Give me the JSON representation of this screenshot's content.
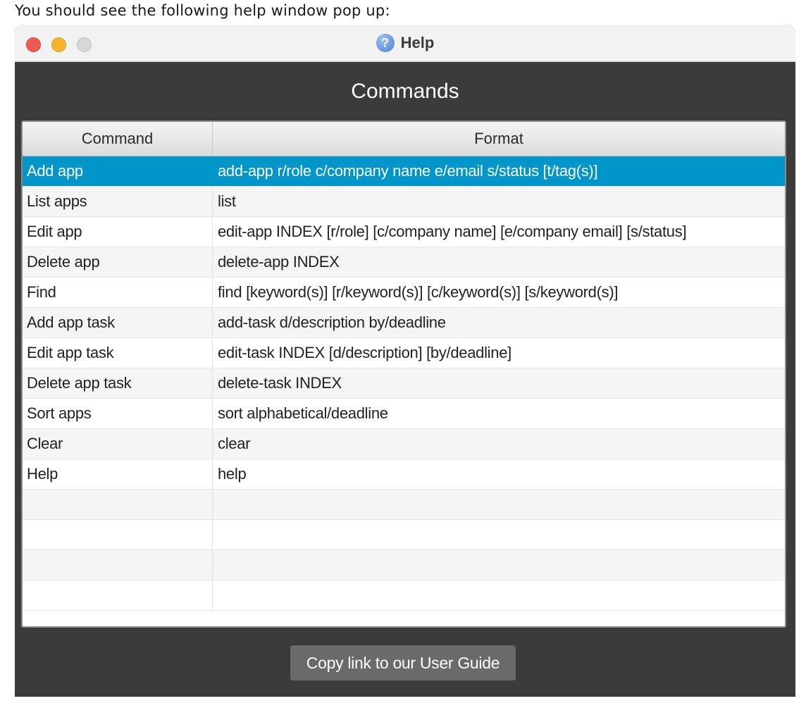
{
  "intro_text": "You should see the following help window pop up:",
  "window": {
    "title": "Help",
    "heading": "Commands"
  },
  "table": {
    "columns": [
      "Command",
      "Format"
    ],
    "selected_row": 0,
    "rows": [
      {
        "command": "Add app",
        "format": "add-app r/role c/company name e/email s/status [t/tag(s)]"
      },
      {
        "command": "List apps",
        "format": "list"
      },
      {
        "command": "Edit app",
        "format": "edit-app INDEX [r/role] [c/company name] [e/company email] [s/status]"
      },
      {
        "command": "Delete app",
        "format": "delete-app INDEX"
      },
      {
        "command": "Find",
        "format": "find [keyword(s)] [r/keyword(s)] [c/keyword(s)] [s/keyword(s)]"
      },
      {
        "command": "Add app task",
        "format": "add-task d/description by/deadline"
      },
      {
        "command": "Edit app task",
        "format": "edit-task INDEX [d/description] [by/deadline]"
      },
      {
        "command": "Delete app task",
        "format": "delete-task INDEX"
      },
      {
        "command": "Sort apps",
        "format": "sort alphabetical/deadline"
      },
      {
        "command": "Clear",
        "format": "clear"
      },
      {
        "command": "Help",
        "format": "help"
      },
      {
        "command": "",
        "format": ""
      },
      {
        "command": "",
        "format": ""
      },
      {
        "command": "",
        "format": ""
      },
      {
        "command": "",
        "format": ""
      }
    ]
  },
  "copy_button_label": "Copy link to our User Guide",
  "colors": {
    "selected_row": "#0096c9",
    "window_bg": "#3b3b3b",
    "button_bg": "#6a6a6a"
  }
}
